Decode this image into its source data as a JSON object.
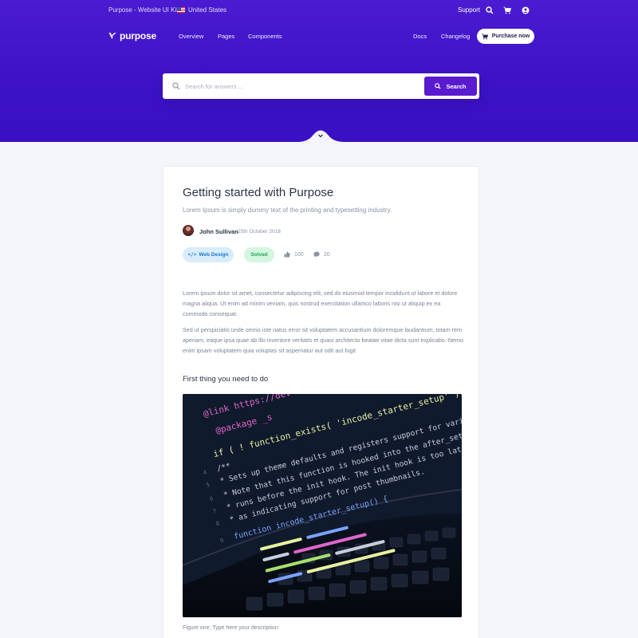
{
  "topbar": {
    "brand_text": "Purpose - Website UI Kit",
    "country": "United States",
    "support": "Support"
  },
  "nav": {
    "logo": "purpose",
    "links": [
      "Overview",
      "Pages",
      "Components"
    ],
    "right_links": [
      "Docs",
      "Changelog"
    ],
    "cta": "Purchase now"
  },
  "search": {
    "placeholder": "Search for answers ...",
    "button": "Search"
  },
  "article": {
    "title": "Getting started with Purpose",
    "subtitle": "Lorem Ipsum is simply dummy text of the printing and typesetting industry.",
    "author": "John Sullivan",
    "date": "25th October 2018",
    "tags": [
      "Web Design",
      "Solved"
    ],
    "likes": "100",
    "comments": "20",
    "paragraphs": [
      "Lorem ipsum dolor sit amet, consectetur adipiscing elit, sed do eiusmod tempor incididunt ut labore et dolore magna aliqua. Ut enim ad minim veniam, quis nostrud exercitation ullamco laboris nisi ut aliquip ex ea commodo consequat.",
      "Sed ut perspiciatis unde omnis iste natus error sit voluptatem accusantium doloremque laudantium, totam rem aperiam, eaque ipsa quae ab illo inventore veritatis et quasi architecto beatae vitae dicta sunt explicabo. Nemo enim ipsam voluptatem quia voluptas sit aspernatur aut odit aut fugit"
    ],
    "section_heading": "First thing you need to do",
    "figure_caption": "Figure one: Type here your description"
  },
  "figure_code": {
    "line1": "@link https://dev",
    "line2": "@package _s",
    "line3": "if ( ! function_exists( 'incode_starter_setup' ) ) :",
    "line4": "/**",
    "line5": " * Sets up theme defaults and registers support for various WordPress",
    "line6": " * Note that this function is hooked into the after_setup_theme hook",
    "line7": " * runs before the init hook. The init hook is too late for some feat",
    "line8": " * as indicating support for post thumbnails.",
    "line9": "function incode_starter_setup() {"
  },
  "colors": {
    "hero": "#3d12c6",
    "accent": "#5a1ad0",
    "web_badge_bg": "#d8ecfb",
    "solved_badge_bg": "#d4f5df"
  },
  "icons": {
    "search": "search-icon",
    "cart": "cart-icon",
    "user": "user-icon",
    "thumbs_up": "thumbs-up-icon",
    "comment": "comment-icon",
    "chevron": "chevron-down-icon"
  }
}
